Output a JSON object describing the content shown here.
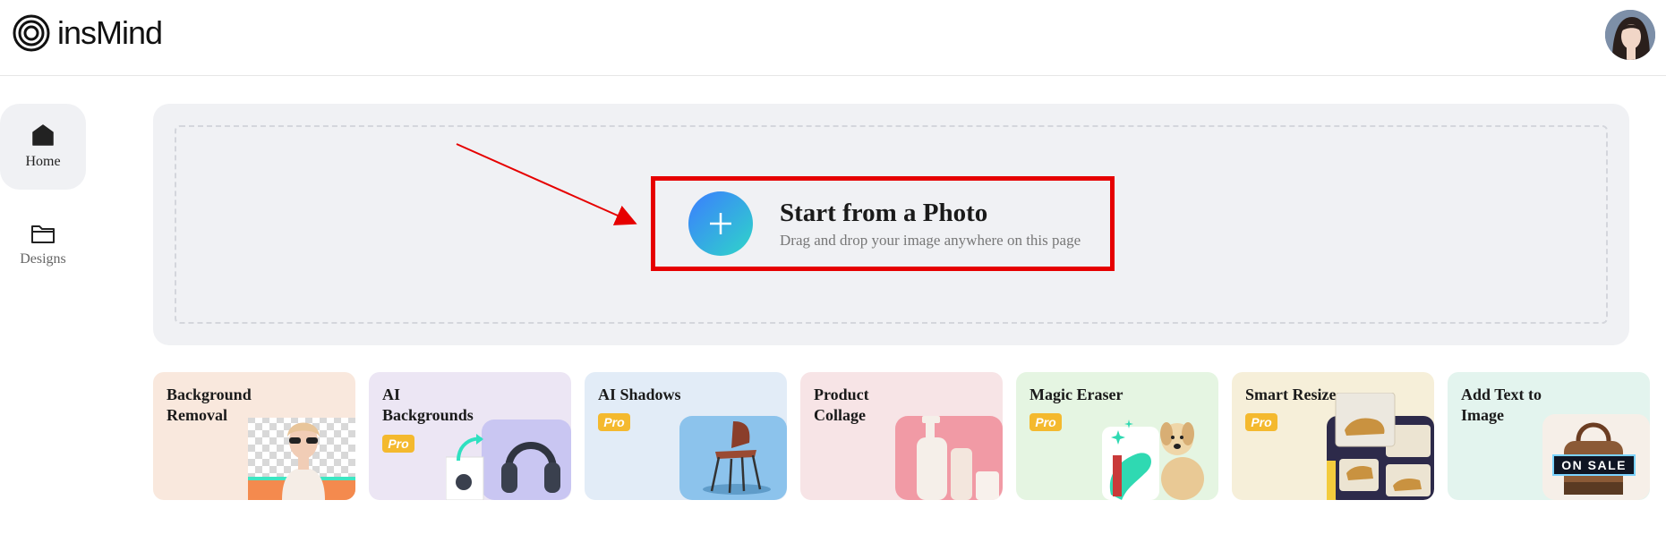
{
  "header": {
    "brand": "insMind",
    "logo_icon": "concentric-circles-logo-icon",
    "avatar_icon": "user-avatar"
  },
  "sidebar": {
    "items": [
      {
        "label": "Home",
        "icon": "home-icon",
        "active": true
      },
      {
        "label": "Designs",
        "icon": "folder-icon",
        "active": false
      }
    ]
  },
  "upload": {
    "title": "Start from a Photo",
    "subtitle": "Drag and drop your image anywhere on this page",
    "highlight_color": "#e60000"
  },
  "tools": [
    {
      "title": "Background Removal",
      "pro": "",
      "bg": "#f9e8dd"
    },
    {
      "title": "AI Backgrounds",
      "pro": "Pro",
      "bg": "#ece6f4"
    },
    {
      "title": "AI Shadows",
      "pro": "Pro",
      "bg": "#e2ecf7"
    },
    {
      "title": "Product Collage",
      "pro": "",
      "bg": "#f7e4e6"
    },
    {
      "title": "Magic Eraser",
      "pro": "Pro",
      "bg": "#e5f5e2"
    },
    {
      "title": "Smart Resize",
      "pro": "Pro",
      "bg": "#f6efd9"
    },
    {
      "title": "Add Text to Image",
      "pro": "",
      "bg": "#e3f4ee",
      "sticker": "ON SALE"
    }
  ]
}
